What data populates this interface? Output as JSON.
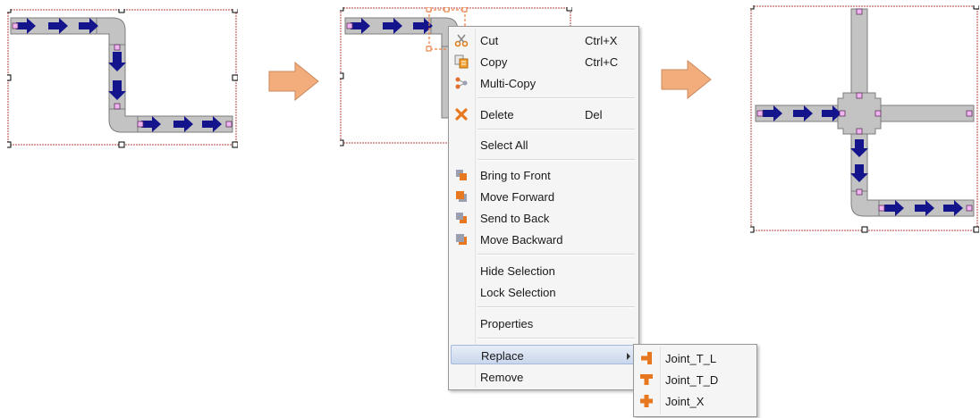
{
  "context_menu": {
    "items": [
      {
        "label": "Cut",
        "shortcut": "Ctrl+X",
        "icon": "scissors-icon"
      },
      {
        "label": "Copy",
        "shortcut": "Ctrl+C",
        "icon": "copy-icon"
      },
      {
        "label": "Multi-Copy",
        "icon": "multi-copy-icon"
      },
      {
        "label": "Delete",
        "shortcut": "Del",
        "icon": "delete-icon"
      },
      {
        "label": "Select All"
      },
      {
        "label": "Bring to Front",
        "icon": "bring-to-front-icon"
      },
      {
        "label": "Move Forward",
        "icon": "move-forward-icon"
      },
      {
        "label": "Send to Back",
        "icon": "send-to-back-icon"
      },
      {
        "label": "Move Backward",
        "icon": "move-backward-icon"
      },
      {
        "label": "Hide Selection"
      },
      {
        "label": "Lock Selection"
      },
      {
        "label": "Properties"
      },
      {
        "label": "Replace",
        "highlighted": true,
        "has_submenu": true
      },
      {
        "label": "Remove"
      }
    ]
  },
  "replace_submenu": {
    "items": [
      {
        "label": "Joint_T_L",
        "icon": "joint-t-left-icon"
      },
      {
        "label": "Joint_T_D",
        "icon": "joint-t-down-icon"
      },
      {
        "label": "Joint_X",
        "icon": "joint-cross-icon"
      }
    ]
  },
  "colors": {
    "pipe_fill": "#c3c3c3",
    "pipe_stroke": "#7d7d7d",
    "flow_arrow": "#14148c",
    "selection_border": "#d08080",
    "handle_pink": "#f0b4f0",
    "step_arrow": "#f3ad7d",
    "menu_highlight": "#c9d6ec"
  }
}
